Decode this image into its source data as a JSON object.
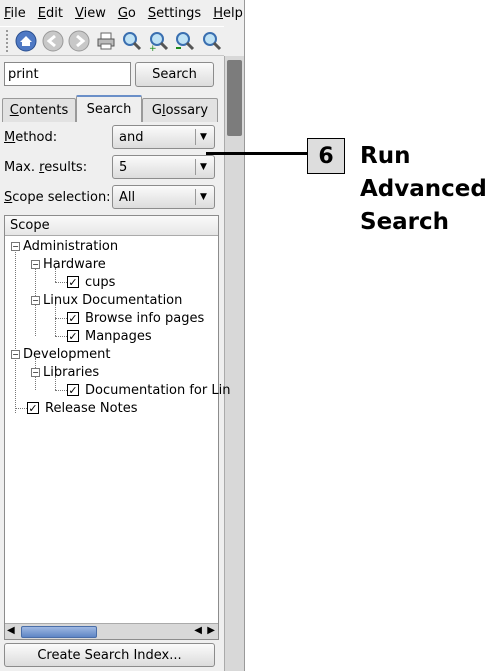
{
  "menubar": {
    "items": [
      {
        "mnemonic": "F",
        "rest": "ile"
      },
      {
        "mnemonic": "E",
        "rest": "dit"
      },
      {
        "mnemonic": "V",
        "rest": "iew"
      },
      {
        "mnemonic": "G",
        "rest": "o"
      },
      {
        "mnemonic": "S",
        "rest": "ettings"
      },
      {
        "mnemonic": "H",
        "rest": "elp"
      }
    ]
  },
  "toolbar": {
    "icons": [
      "home-icon",
      "back-icon",
      "forward-icon",
      "print-icon",
      "find-icon",
      "zoom-in-icon",
      "zoom-out-icon",
      "zoom-icon"
    ]
  },
  "search": {
    "value": "print",
    "button_label": "Search"
  },
  "tabs": [
    {
      "mnemonic": "C",
      "rest": "ontents",
      "prefix": ""
    },
    {
      "mnemonic": "",
      "rest": "Search",
      "prefix": ""
    },
    {
      "mnemonic": "l",
      "rest": "ossary",
      "prefix": "G"
    }
  ],
  "form": {
    "method_label": {
      "mnemonic": "M",
      "rest": "ethod:"
    },
    "method_value": "and",
    "max_results_label": {
      "prefix": "Max. ",
      "mnemonic": "r",
      "rest": "esults:"
    },
    "max_results_value": "5",
    "scope_label": {
      "mnemonic": "S",
      "rest": "cope selection:"
    },
    "scope_value": "All"
  },
  "tree": {
    "header": "Scope",
    "nodes": {
      "administration": "Administration",
      "hardware": "Hardware",
      "cups": "cups",
      "linux_doc": "Linux Documentation",
      "browse_info": "Browse info pages",
      "manpages": "Manpages",
      "development": "Development",
      "libraries": "Libraries",
      "doc_for_lin": "Documentation for Lin",
      "release_notes": "Release Notes"
    }
  },
  "create_index_button": "Create Search Index...",
  "callout": {
    "step": "6",
    "lines": [
      "Run",
      "Advanced",
      "Search"
    ]
  },
  "colors": {
    "accent": "#5f86c5",
    "tab_highlight": "#6a8fc8"
  }
}
